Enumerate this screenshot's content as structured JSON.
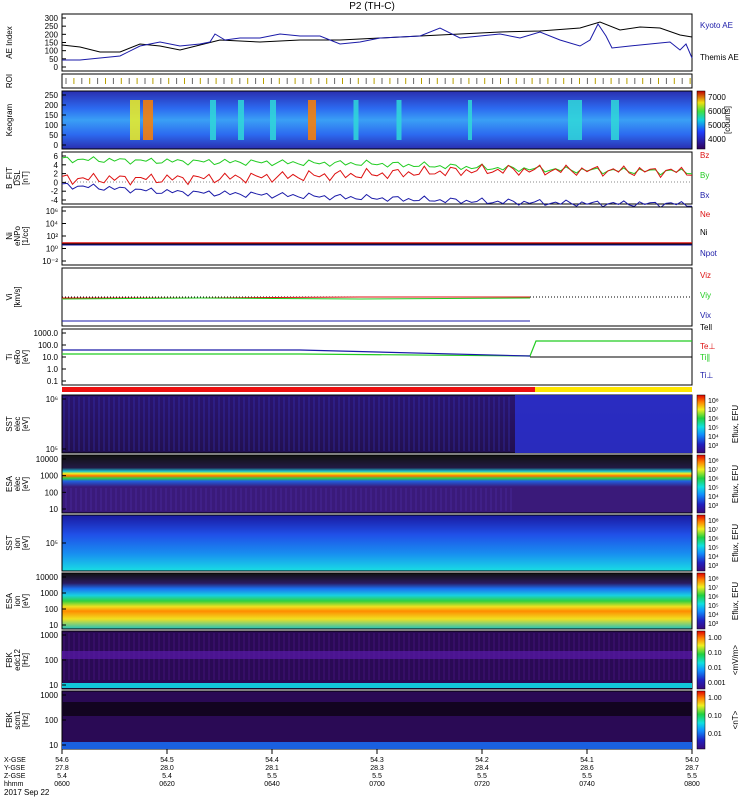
{
  "title": "P2 (TH-C)",
  "date_label": "2017 Sep 22",
  "colors": {
    "blue": "#1a1aa8",
    "green": "#22cc22",
    "red": "#dd1111",
    "bar_red": "#ee1111",
    "bar_yellow": "#ffe600"
  },
  "time_axis": {
    "ticks": [
      "0600",
      "0620",
      "0640",
      "0700",
      "0720",
      "0740",
      "0800"
    ],
    "row_labels": [
      "X-GSE",
      "Y-GSE",
      "Z-GSE",
      "hhmm"
    ],
    "rows": {
      "x": [
        "54.6",
        "54.5",
        "54.4",
        "54.3",
        "54.2",
        "54.1",
        "54.0"
      ],
      "y": [
        "27.8",
        "28.0",
        "28.1",
        "28.3",
        "28.4",
        "28.6",
        "28.7"
      ],
      "z": [
        "5.4",
        "5.4",
        "5.5",
        "5.5",
        "5.5",
        "5.5",
        "5.5"
      ]
    }
  },
  "panels": {
    "ae": {
      "ylabel": "AE Index",
      "ticks": [
        "300",
        "250",
        "200",
        "150",
        "100",
        "50",
        "0"
      ],
      "legend": [
        {
          "text": "Kyoto AE",
          "color": "#1a1aa8"
        },
        {
          "text": "Themis AE",
          "color": "#000000"
        }
      ]
    },
    "roi": {
      "ylabel": "ROI"
    },
    "keogram": {
      "ylabel": "Keogram",
      "ticks": [
        "250",
        "200",
        "150",
        "100",
        "50",
        "0"
      ],
      "colorbar_ticks": [
        "7000",
        "6000",
        "5000",
        "4000"
      ],
      "colorbar_unit": "[counts]"
    },
    "bfield": {
      "ylabel": "B_FIT",
      "ylabel2": "DSL",
      "ylabel3": "[nT]",
      "ticks": [
        "6",
        "4",
        "2",
        "0",
        "-2",
        "-4"
      ],
      "legend": [
        {
          "text": "Bz",
          "color": "#dd1111"
        },
        {
          "text": "By",
          "color": "#22cc22"
        },
        {
          "text": "Bx",
          "color": "#1a1aa8"
        }
      ]
    },
    "density": {
      "ylabel": "Ni",
      "ylabel2": "eNPo",
      "ylabel3": "[1/cc]",
      "ticks": [
        "10⁶",
        "10⁴",
        "10²",
        "10⁰",
        "10⁻²"
      ],
      "legend": [
        {
          "text": "Ne",
          "color": "#dd1111"
        },
        {
          "text": "Ni",
          "color": "#000000"
        },
        {
          "text": "Npot",
          "color": "#1a1aa8"
        }
      ]
    },
    "velocity": {
      "ylabel": "Vi",
      "ylabel2": "[km/s]",
      "legend": [
        {
          "text": "Viz",
          "color": "#dd1111"
        },
        {
          "text": "Viy",
          "color": "#22cc22"
        },
        {
          "text": "Vix",
          "color": "#1a1aa8"
        }
      ]
    },
    "temp": {
      "ylabel": "Ti",
      "ylabel2": "eRo",
      "ylabel3": "[eV]",
      "ticks": [
        "1000.0",
        "100.0",
        "10.0",
        "1.0",
        "0.1"
      ],
      "legend": [
        {
          "text": "Tell",
          "color": "#000000"
        },
        {
          "text": "Te⊥",
          "color": "#dd1111"
        },
        {
          "text": "Ti∥",
          "color": "#22cc22"
        },
        {
          "text": "Ti⊥",
          "color": "#1a1aa8"
        }
      ]
    },
    "sst_e": {
      "ylabel": "SST",
      "ylabel2": "elec",
      "ylabel3": "[eV]",
      "ticks": [
        "10⁶",
        "10⁵"
      ]
    },
    "esa_e": {
      "ylabel": "ESA",
      "ylabel2": "elec",
      "ylabel3": "[eV]",
      "ticks": [
        "10000",
        "1000",
        "100",
        "10"
      ]
    },
    "sst_i": {
      "ylabel": "SST",
      "ylabel2": "ion",
      "ylabel3": "[eV]",
      "ticks": [
        "10⁵"
      ]
    },
    "esa_i": {
      "ylabel": "ESA",
      "ylabel2": "ion",
      "ylabel3": "[eV]",
      "ticks": [
        "10000",
        "1000",
        "100",
        "10"
      ]
    },
    "fbk_b": {
      "ylabel": "FBK",
      "ylabel2": "scm1",
      "ylabel3": "[Hz]",
      "ticks": [
        "1000",
        "100",
        "10"
      ]
    },
    "fbk_e": {
      "ylabel": "FBK",
      "ylabel2": "edc12",
      "ylabel3": "[Hz]",
      "ticks": [
        "1000",
        "100",
        "10"
      ]
    }
  },
  "colorbars": {
    "eflux_ticks": [
      "10⁸",
      "10⁷",
      "10⁶",
      "10⁵",
      "10⁴",
      "10³"
    ],
    "eflux_label": "Eflux, EFU",
    "fbk_b_ticks": [
      "1.00",
      "0.10",
      "0.01"
    ],
    "fbk_b_label": "<nT>",
    "fbk_e_ticks": [
      "1.00",
      "0.10",
      "0.01",
      "0.001"
    ],
    "fbk_e_label": "<mV/m>"
  },
  "chart_data": {
    "type": "line",
    "title": "P2 (TH-C)",
    "x_range": [
      "0600",
      "0800"
    ],
    "series": [
      {
        "name": "Kyoto AE",
        "x": [
          "0600",
          "0610",
          "0620",
          "0630",
          "0640",
          "0650",
          "0700",
          "0710",
          "0720",
          "0730",
          "0740",
          "0742",
          "0750",
          "0800"
        ],
        "values": [
          90,
          70,
          145,
          120,
          170,
          160,
          150,
          160,
          200,
          190,
          210,
          240,
          120,
          60
        ]
      },
      {
        "name": "Themis AE",
        "x": [
          "0600",
          "0610",
          "0620",
          "0630",
          "0640",
          "0650",
          "0700",
          "0710",
          "0720",
          "0730",
          "0740",
          "0750",
          "0800"
        ],
        "values": [
          150,
          130,
          160,
          140,
          180,
          180,
          170,
          180,
          220,
          200,
          240,
          210,
          170
        ]
      },
      {
        "name": "Bz",
        "x": [
          "0600",
          "0620",
          "0640",
          "0700",
          "0720",
          "0740",
          "0800"
        ],
        "values": [
          0.5,
          0.5,
          0.8,
          1.2,
          1.8,
          1.8,
          1.6
        ]
      },
      {
        "name": "By",
        "x": [
          "0600",
          "0620",
          "0640",
          "0700",
          "0720",
          "0740",
          "0800"
        ],
        "values": [
          3.5,
          3.2,
          3.0,
          2.8,
          2.2,
          1.8,
          1.6
        ]
      },
      {
        "name": "Bx",
        "x": [
          "0600",
          "0620",
          "0640",
          "0700",
          "0720",
          "0740",
          "0800"
        ],
        "values": [
          -0.5,
          -1.5,
          -2.0,
          -2.5,
          -3.0,
          -3.3,
          -3.4
        ]
      }
    ]
  }
}
